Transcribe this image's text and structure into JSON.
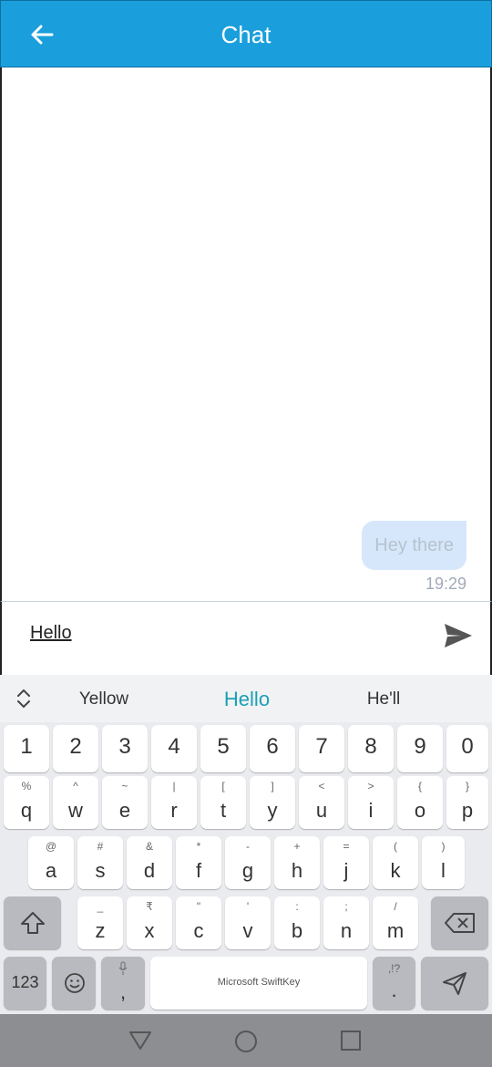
{
  "app_bar": {
    "title": "Chat"
  },
  "chat": {
    "messages": [
      {
        "text": "Hey there",
        "time": "19:29"
      }
    ]
  },
  "composer": {
    "value": "Hello"
  },
  "keyboard": {
    "suggestions": [
      "Yellow",
      "Hello",
      "He'll"
    ],
    "number_row": [
      "1",
      "2",
      "3",
      "4",
      "5",
      "6",
      "7",
      "8",
      "9",
      "0"
    ],
    "row1": [
      {
        "main": "q",
        "sec": "%"
      },
      {
        "main": "w",
        "sec": "^"
      },
      {
        "main": "e",
        "sec": "~"
      },
      {
        "main": "r",
        "sec": "|"
      },
      {
        "main": "t",
        "sec": "["
      },
      {
        "main": "y",
        "sec": "]"
      },
      {
        "main": "u",
        "sec": "<"
      },
      {
        "main": "i",
        "sec": ">"
      },
      {
        "main": "o",
        "sec": "{"
      },
      {
        "main": "p",
        "sec": "}"
      }
    ],
    "row2": [
      {
        "main": "a",
        "sec": "@"
      },
      {
        "main": "s",
        "sec": "#"
      },
      {
        "main": "d",
        "sec": "&"
      },
      {
        "main": "f",
        "sec": "*"
      },
      {
        "main": "g",
        "sec": "-"
      },
      {
        "main": "h",
        "sec": "+"
      },
      {
        "main": "j",
        "sec": "="
      },
      {
        "main": "k",
        "sec": "("
      },
      {
        "main": "l",
        "sec": ")"
      }
    ],
    "row3": [
      {
        "main": "z",
        "sec": "_"
      },
      {
        "main": "x",
        "sec": "₹"
      },
      {
        "main": "c",
        "sec": "\""
      },
      {
        "main": "v",
        "sec": "'"
      },
      {
        "main": "b",
        "sec": ":"
      },
      {
        "main": "n",
        "sec": ";"
      },
      {
        "main": "m",
        "sec": "/"
      }
    ],
    "bottom": {
      "numbers_label": "123",
      "comma_main": ",",
      "space_label": "Microsoft SwiftKey",
      "period_main": ".",
      "period_sec": ",!?"
    }
  },
  "colors": {
    "app_bar": "#1a9fdc",
    "bubble": "#d7e7fb",
    "suggestion_highlight": "#1aa0b5"
  }
}
